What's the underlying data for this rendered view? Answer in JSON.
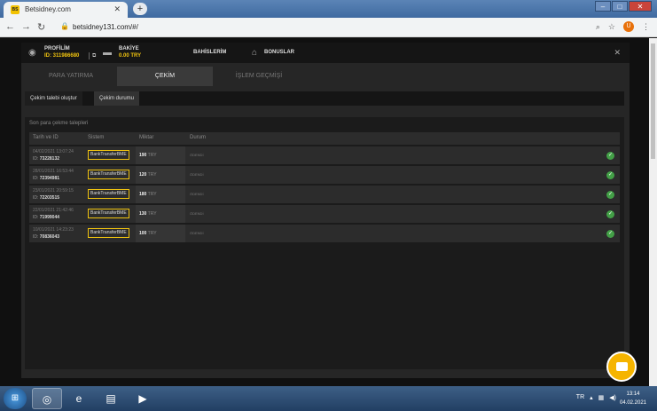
{
  "browser": {
    "tab_title": "Betsidney.com",
    "tab_close": "✕",
    "new_tab": "+",
    "url": "betsidney131.com/#/",
    "favicon_text": "BS"
  },
  "header": {
    "profile_label": "PROFİLİM",
    "profile_id": "ID: 311986680",
    "balance_label": "BAKİYE",
    "balance_value": "0.00 TRY",
    "bets_label": "BAHİSLERİM",
    "bonus_label": "BONUSLAR",
    "close": "✕"
  },
  "tabs": [
    "PARA YATIRMA",
    "ÇEKİM",
    "İŞLEM GEÇMİŞİ"
  ],
  "subtabs": [
    "Çekim talebi oluştur",
    "Çekim durumu"
  ],
  "panel": {
    "title": "Son para çekme talepleri",
    "columns": [
      "Tarih ve ID",
      "Sistem",
      "Miktar",
      "Durum"
    ]
  },
  "rows": [
    {
      "date": "04/02/2021 13:07:24",
      "id": "73228132",
      "system": "BankTransferBME",
      "amount": "190",
      "currency": "TRY",
      "status": "ÖDENDİ"
    },
    {
      "date": "28/01/2021 16:53:44",
      "id": "72394981",
      "system": "BankTransferBME",
      "amount": "120",
      "currency": "TRY",
      "status": "ÖDENDİ"
    },
    {
      "date": "23/01/2021 20:59:15",
      "id": "72203515",
      "system": "BankTransferBME",
      "amount": "180",
      "currency": "TRY",
      "status": "ÖDENDİ"
    },
    {
      "date": "22/01/2021 21:42:46",
      "id": "71999044",
      "system": "BankTransferBME",
      "amount": "130",
      "currency": "TRY",
      "status": "ÖDENDİ"
    },
    {
      "date": "10/01/2021 14:23:23",
      "id": "70836043",
      "system": "BankTransferBME",
      "amount": "100",
      "currency": "TRY",
      "status": "ÖDENDİ"
    }
  ],
  "taskbar": {
    "lang": "TR",
    "time": "13:14",
    "date": "04.02.2021"
  },
  "colors": {
    "accent": "#f1c40f",
    "success": "#43a047"
  }
}
